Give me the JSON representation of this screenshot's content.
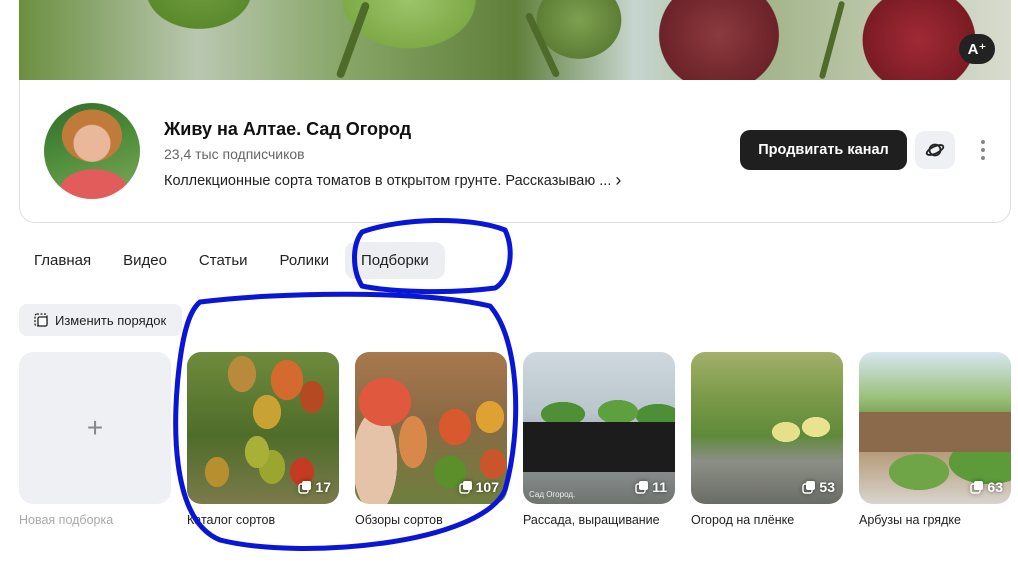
{
  "header": {
    "translate_label": "A⁺"
  },
  "channel": {
    "title": "Живу на Алтае. Сад Огород",
    "subscribers": "23,4 тыс подписчиков",
    "description": "Коллекционные сорта томатов в открытом грунте. Рассказываю ...",
    "promote_label": "Продвигать канал"
  },
  "tabs": [
    {
      "label": "Главная"
    },
    {
      "label": "Видео"
    },
    {
      "label": "Статьи"
    },
    {
      "label": "Ролики"
    },
    {
      "label": "Подборки"
    }
  ],
  "active_tab": "Подборки",
  "reorder_label": "Изменить порядок",
  "new_collection_label": "Новая подборка",
  "collections": [
    {
      "label": "Каталог сортов",
      "count": "17"
    },
    {
      "label": "Обзоры сортов",
      "count": "107"
    },
    {
      "label": "Рассада, выращивание",
      "count": "11",
      "image_caption": "Сад Огород."
    },
    {
      "label": "Огород на плёнке",
      "count": "53"
    },
    {
      "label": "Арбузы на грядке",
      "count": "63"
    }
  ],
  "colors": {
    "annotation": "#0a16d6",
    "primary_button": "#1f1f1f",
    "active_tab_bg": "#eceef1"
  }
}
